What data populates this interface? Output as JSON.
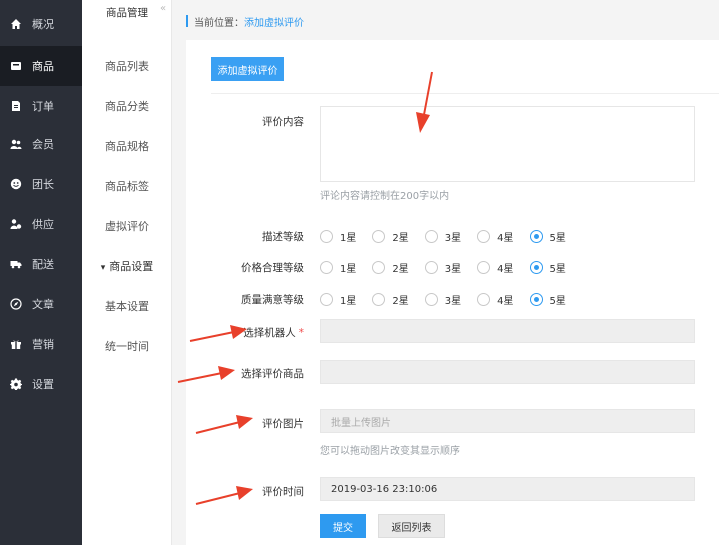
{
  "sidebar": {
    "items": [
      {
        "label": "概况",
        "icon": "home-icon"
      },
      {
        "label": "商品",
        "icon": "product-icon"
      },
      {
        "label": "订单",
        "icon": "order-icon"
      },
      {
        "label": "会员",
        "icon": "members-icon"
      },
      {
        "label": "团长",
        "icon": "leader-icon"
      },
      {
        "label": "供应",
        "icon": "supplier-icon"
      },
      {
        "label": "配送",
        "icon": "truck-icon"
      },
      {
        "label": "文章",
        "icon": "compass-icon"
      },
      {
        "label": "营销",
        "icon": "gift-icon"
      },
      {
        "label": "设置",
        "icon": "gear-icon"
      }
    ],
    "active_index": 1
  },
  "subnav": {
    "title": "商品管理",
    "items": [
      "商品列表",
      "商品分类",
      "商品规格",
      "商品标签",
      "虚拟评价",
      "商品设置",
      "基本设置",
      "统一时间"
    ],
    "collapse_glyph": "«",
    "expand_glyph": "▾"
  },
  "breadcrumb": {
    "prefix": "当前位置：",
    "current": "添加虚拟评价"
  },
  "form": {
    "top_button": "添加虚拟评价",
    "content_label": "评价内容",
    "content_hint": "评论内容请控制在200字以内",
    "rating_rows": [
      {
        "label": "描述等级",
        "selected": 4
      },
      {
        "label": "价格合理等级",
        "selected": 4
      },
      {
        "label": "质量满意等级",
        "selected": 4
      }
    ],
    "rating_options": [
      "1星",
      "2星",
      "3星",
      "4星",
      "5星"
    ],
    "robot_label": "选择机器人",
    "required_mark": "*",
    "product_label": "选择评价商品",
    "image_label": "评价图片",
    "image_placeholder": "批量上传图片",
    "image_hint": "您可以拖动图片改变其显示顺序",
    "time_label": "评价时间",
    "time_value": "2019-03-16 23:10:06",
    "submit": "提交",
    "back": "返回列表"
  },
  "colors": {
    "accent": "#2e9af0",
    "sidebar_bg": "#2b2f38",
    "arrow": "#e8402b"
  }
}
